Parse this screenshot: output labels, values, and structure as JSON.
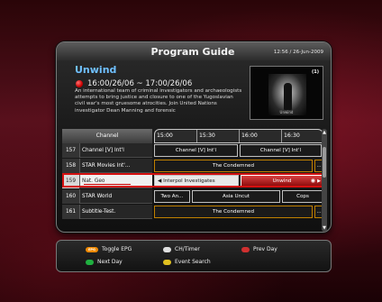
{
  "header": {
    "title": "Program Guide",
    "clock": "12:56 / 26-Jun-2009"
  },
  "event": {
    "title": "Unwind",
    "time": "16:00/26/06 ~ 17:00/26/06",
    "description": "An international team of criminal investigators and archaeologists attempts to bring justice and closure to one of the Yugoslavian civil war's most gruesome atrocities. Join United Nations investigator Dean Manning and forensic"
  },
  "preview": {
    "channel_logo": "(1)",
    "caption": "Unwind"
  },
  "grid": {
    "channel_header": "Channel",
    "times": [
      "15:00",
      "15:30",
      "16:00",
      "16:30"
    ],
    "channels": [
      {
        "num": "157",
        "name": "Channel [V] Int'l",
        "selected": false,
        "programs": [
          {
            "title": "Channel [V] Int'l"
          },
          {
            "title": "Channel [V] Int'l"
          }
        ]
      },
      {
        "num": "158",
        "name": "STAR Movies Int'...",
        "selected": false,
        "programs": [
          {
            "title": "The Condemned"
          },
          {
            "title": "..."
          }
        ]
      },
      {
        "num": "159",
        "name": "Nat. Geo",
        "selected": true,
        "programs": [
          {
            "title": "◀ Interpol Investigates"
          },
          {
            "title": "Unwind"
          }
        ]
      },
      {
        "num": "160",
        "name": "STAR World",
        "selected": false,
        "programs": [
          {
            "title": "Two An..."
          },
          {
            "title": "Asia Uncut"
          },
          {
            "title": "Cops"
          }
        ]
      },
      {
        "num": "161",
        "name": "Subtitle-Test.",
        "selected": false,
        "programs": [
          {
            "title": "The Condemned"
          },
          {
            "title": "..."
          }
        ]
      }
    ]
  },
  "legend": {
    "epg_badge": "EPG",
    "toggle_epg": "Toggle EPG",
    "ch_timer": "CH/Timer",
    "prev_day": "Prev Day",
    "next_day": "Next Day",
    "event_search": "Event Search"
  },
  "colors": {
    "accent_title": "#6fc0ff",
    "selection": "#d41010",
    "epg_key": "#f08a00",
    "green_key": "#20b040",
    "yellow_key": "#e0c020",
    "red_key": "#d03030",
    "white_key": "#e0e0e0"
  }
}
